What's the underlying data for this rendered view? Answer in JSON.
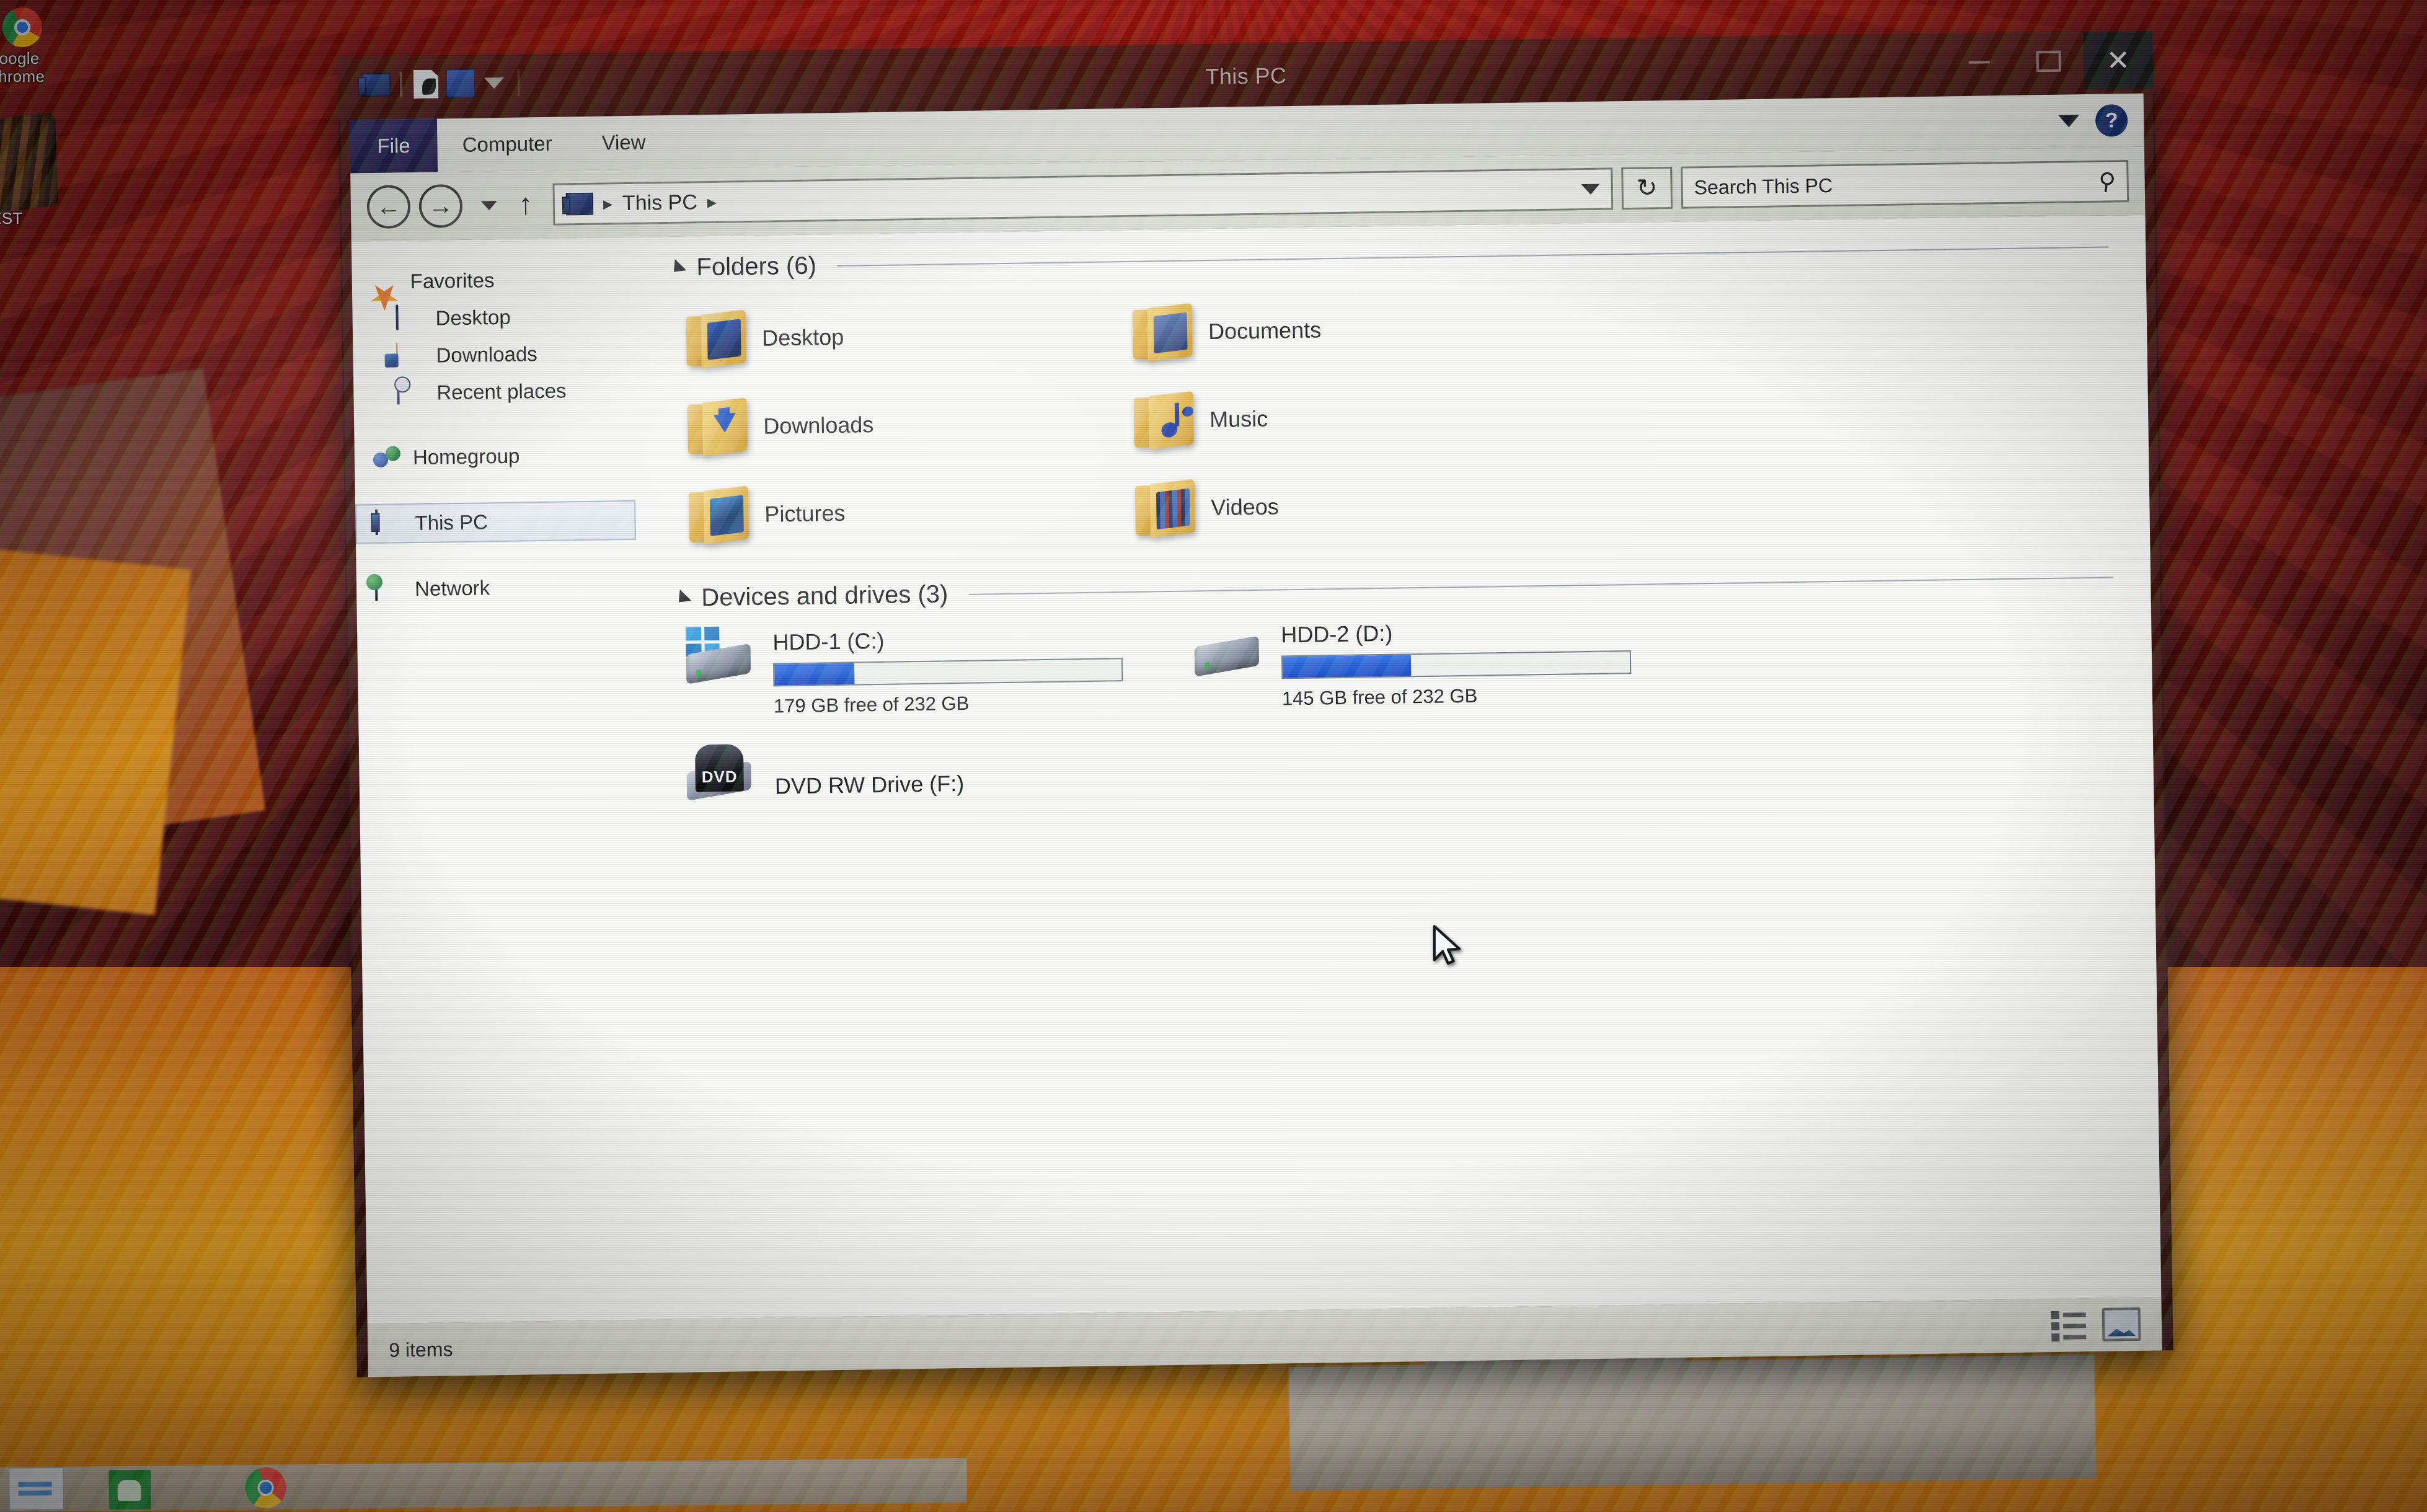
{
  "desktop": {
    "icons": [
      {
        "label": "Google\nChrome",
        "icon": "chrome-icon"
      },
      {
        "label": "UEST",
        "icon": "guitar-icon"
      }
    ]
  },
  "taskbar": {
    "items": [
      {
        "name": "start-button",
        "icon": "windows-start-icon"
      },
      {
        "name": "taskbar-app-green",
        "icon": "bag-icon"
      },
      {
        "name": "taskbar-app-chrome",
        "icon": "chrome-icon"
      }
    ]
  },
  "window": {
    "title": "This PC",
    "quick_access": [
      {
        "name": "this-pc-icon",
        "icon": "computer-icon"
      },
      {
        "name": "properties-icon",
        "icon": "properties-icon"
      },
      {
        "name": "new-folder-icon",
        "icon": "new-folder-icon"
      },
      {
        "name": "customize-qat-icon",
        "icon": "chevron-down-icon"
      }
    ],
    "controls": {
      "minimize": "–",
      "maximize": "❐",
      "close": "✕"
    }
  },
  "ribbon": {
    "tabs": [
      {
        "label": "File",
        "active": true
      },
      {
        "label": "Computer",
        "active": false
      },
      {
        "label": "View",
        "active": false
      }
    ],
    "expand_icon": "chevron-down-icon",
    "help_label": "?"
  },
  "navbar": {
    "back_icon": "←",
    "forward_icon": "→",
    "recent_icon": "chevron-down-icon",
    "up_icon": "↑",
    "breadcrumb": {
      "root_icon": "computer-icon",
      "crumbs": [
        "This PC"
      ],
      "separator": "▸"
    },
    "refresh_icon": "↻",
    "dropdown_icon": "chevron-down-icon"
  },
  "search": {
    "placeholder": "Search This PC",
    "icon": "search-icon"
  },
  "navpane": {
    "items": [
      {
        "label": "Favorites",
        "icon": "star-icon",
        "indent": false,
        "selected": false,
        "gap": false
      },
      {
        "label": "Desktop",
        "icon": "desktop-icon",
        "indent": true,
        "selected": false,
        "gap": false
      },
      {
        "label": "Downloads",
        "icon": "downloads-folder-icon",
        "indent": true,
        "selected": false,
        "gap": false
      },
      {
        "label": "Recent places",
        "icon": "recent-places-icon",
        "indent": true,
        "selected": false,
        "gap": false
      },
      {
        "label": "Homegroup",
        "icon": "homegroup-icon",
        "indent": false,
        "selected": false,
        "gap": true
      },
      {
        "label": "This PC",
        "icon": "computer-icon",
        "indent": false,
        "selected": true,
        "gap": true
      },
      {
        "label": "Network",
        "icon": "network-icon",
        "indent": false,
        "selected": false,
        "gap": true
      }
    ]
  },
  "content": {
    "folders_group": {
      "label": "Folders (6)",
      "collapse_icon": "triangle-collapse-icon",
      "items": [
        {
          "label": "Desktop",
          "icon": "desktop-folder-icon"
        },
        {
          "label": "Documents",
          "icon": "documents-folder-icon"
        },
        {
          "label": "Downloads",
          "icon": "downloads-folder-icon"
        },
        {
          "label": "Music",
          "icon": "music-folder-icon"
        },
        {
          "label": "Pictures",
          "icon": "pictures-folder-icon"
        },
        {
          "label": "Videos",
          "icon": "videos-folder-icon"
        }
      ]
    },
    "drives_group": {
      "label": "Devices and drives (3)",
      "collapse_icon": "triangle-collapse-icon",
      "items": [
        {
          "label": "HDD-1 (C:)",
          "icon": "hard-drive-windows-icon",
          "free_text": "179 GB free of 232 GB",
          "free_gb": 179,
          "total_gb": 232,
          "used_percent": 23,
          "bar_color": "#1246c6"
        },
        {
          "label": "HDD-2 (D:)",
          "icon": "hard-drive-icon",
          "free_text": "145 GB free of 232 GB",
          "free_gb": 145,
          "total_gb": 232,
          "used_percent": 37,
          "bar_color": "#1246c6"
        },
        {
          "label": "DVD RW Drive (F:)",
          "icon": "dvd-drive-icon",
          "badge": "DVD",
          "free_text": "",
          "used_percent": 0
        }
      ]
    }
  },
  "statusbar": {
    "item_count": "9 items",
    "views": [
      {
        "name": "details-view-button",
        "icon": "details-view-icon"
      },
      {
        "name": "large-icons-view-button",
        "icon": "large-icons-view-icon"
      }
    ]
  }
}
